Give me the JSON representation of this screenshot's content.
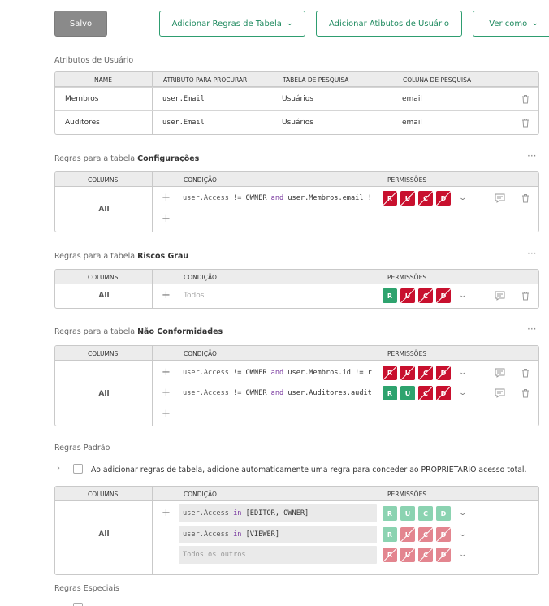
{
  "toolbar": {
    "save": "Salvo",
    "add_table_rules": "Adicionar Regras de Tabela",
    "add_user_attributes": "Adicionar Atibutos de Usuário",
    "view_as": "Ver como"
  },
  "user_attributes": {
    "title": "Atributos de Usuário",
    "headers": [
      "NAME",
      "ATRIBUTO PARA PROCURAR",
      "TABELA DE PESQUISA",
      "COLUNA DE PESQUISA"
    ],
    "rows": [
      {
        "name": "Membros",
        "attr": "user.Email",
        "table": "Usuários",
        "column": "email"
      },
      {
        "name": "Auditores",
        "attr": "user.Email",
        "table": "Usuários",
        "column": "email"
      }
    ]
  },
  "rules_prefix": "Regras para a tabela",
  "rule_headers": {
    "columns": "COLUMNS",
    "condition": "CONDIÇÃO",
    "permissions": "PERMISSÕES"
  },
  "tables": [
    {
      "name": "Configurações",
      "columns": "All",
      "rules": [
        {
          "cond_a": "user.Access",
          "op": " != OWNER ",
          "and": "and",
          "cond_b": " user.Membros.email !",
          "perms": [
            "R",
            "U",
            "C",
            "D"
          ],
          "state": [
            "off",
            "off",
            "off",
            "off"
          ]
        }
      ]
    },
    {
      "name": "Riscos Grau",
      "columns": "All",
      "rules": [
        {
          "placeholder": "Todos",
          "perms": [
            "R",
            "U",
            "C",
            "D"
          ],
          "state": [
            "on",
            "off",
            "off",
            "off"
          ]
        }
      ]
    },
    {
      "name": "Não Conformidades",
      "columns": "All",
      "rules": [
        {
          "cond_a": "user.Access",
          "op": " != OWNER ",
          "and": "and",
          "cond_b": " user.Membros.id != r",
          "perms": [
            "R",
            "U",
            "C",
            "D"
          ],
          "state": [
            "off",
            "off",
            "off",
            "off"
          ]
        },
        {
          "cond_a": "user.Access",
          "op": " != OWNER ",
          "and": "and",
          "cond_b": " user.Auditores.audit",
          "perms": [
            "R",
            "U",
            "C",
            "D"
          ],
          "state": [
            "on",
            "on",
            "off",
            "off"
          ]
        }
      ]
    }
  ],
  "default_rules": {
    "title": "Regras Padrão",
    "checkbox_label": "Ao adicionar regras de tabela, adicione automaticamente uma regra para conceder ao PROPRIETÁRIO acesso total.",
    "columns": "All",
    "rules": [
      {
        "cond_a": "user.Access",
        "in": " in ",
        "cond_b": "[EDITOR, OWNER]",
        "perms": [
          "R",
          "U",
          "C",
          "D"
        ],
        "state": [
          "on",
          "on",
          "on",
          "on"
        ]
      },
      {
        "cond_a": "user.Access",
        "in": " in ",
        "cond_b": "[VIEWER]",
        "perms": [
          "R",
          "U",
          "C",
          "D"
        ],
        "state": [
          "on",
          "off",
          "off",
          "off"
        ]
      },
      {
        "placeholder": "Todos os outros",
        "perms": [
          "R",
          "U",
          "C",
          "D"
        ],
        "state": [
          "off",
          "off",
          "off",
          "off"
        ]
      }
    ]
  },
  "special_rules": {
    "title": "Regras Especiais"
  },
  "colors": {
    "green": "#2ea36e",
    "red": "#c8102e",
    "light_green": "#8bd3b1",
    "light_red": "#e3858f"
  }
}
